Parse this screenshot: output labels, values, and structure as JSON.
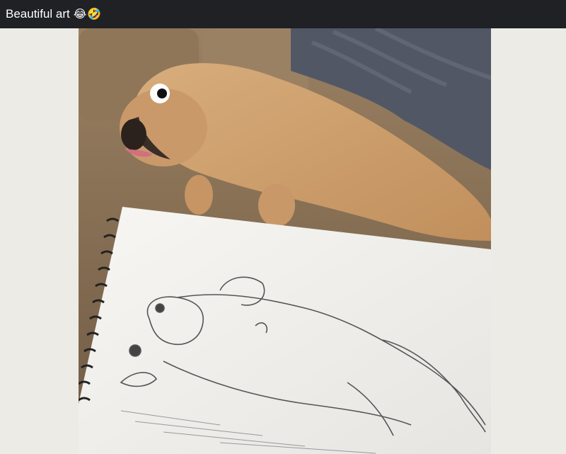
{
  "post": {
    "title": "Beautiful art",
    "emoji": "😂🤣"
  },
  "image": {
    "subject_icons": [
      "pug-photo",
      "pencil-sketch"
    ],
    "colors": {
      "background": "#ecebe6",
      "topbar": "#1f2125",
      "couch": "#8a7358",
      "blanket": "#525766",
      "dog": "#d2a574",
      "paper": "#f2f1ee"
    }
  }
}
